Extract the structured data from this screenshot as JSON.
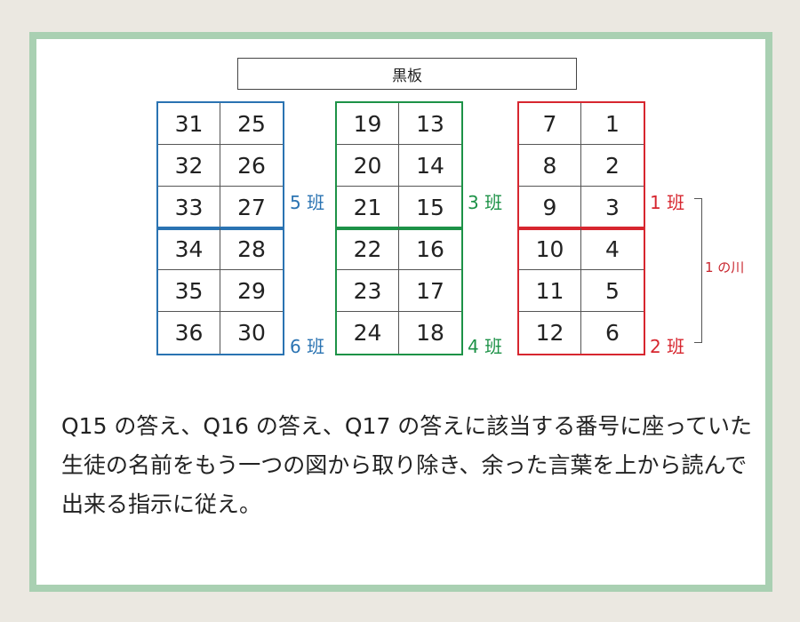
{
  "blackboard": "黒板",
  "colors": {
    "blue": "#2a73b2",
    "green": "#1d9247",
    "red": "#d7262f"
  },
  "left_block": {
    "rows": [
      [
        "31",
        "25"
      ],
      [
        "32",
        "26"
      ],
      [
        "33",
        "27"
      ],
      [
        "34",
        "28"
      ],
      [
        "35",
        "29"
      ],
      [
        "36",
        "30"
      ]
    ],
    "group_top_label": "5 班",
    "group_bottom_label": "6 班"
  },
  "center_block": {
    "rows": [
      [
        "19",
        "13"
      ],
      [
        "20",
        "14"
      ],
      [
        "21",
        "15"
      ],
      [
        "22",
        "16"
      ],
      [
        "23",
        "17"
      ],
      [
        "24",
        "18"
      ]
    ],
    "group_top_label": "3 班",
    "group_bottom_label": "4 班"
  },
  "right_block": {
    "rows": [
      [
        "7",
        "1"
      ],
      [
        "8",
        "2"
      ],
      [
        "9",
        "3"
      ],
      [
        "10",
        "4"
      ],
      [
        "11",
        "5"
      ],
      [
        "12",
        "6"
      ]
    ],
    "group_top_label": "1 班",
    "group_bottom_label": "2 班"
  },
  "river_label": "1 の川",
  "question_text": "Q15 の答え、Q16 の答え、Q17 の答えに該当する番号に座っていた生徒の名前をもう一つの図から取り除き、余った言葉を上から読んで出来る指示に従え。"
}
